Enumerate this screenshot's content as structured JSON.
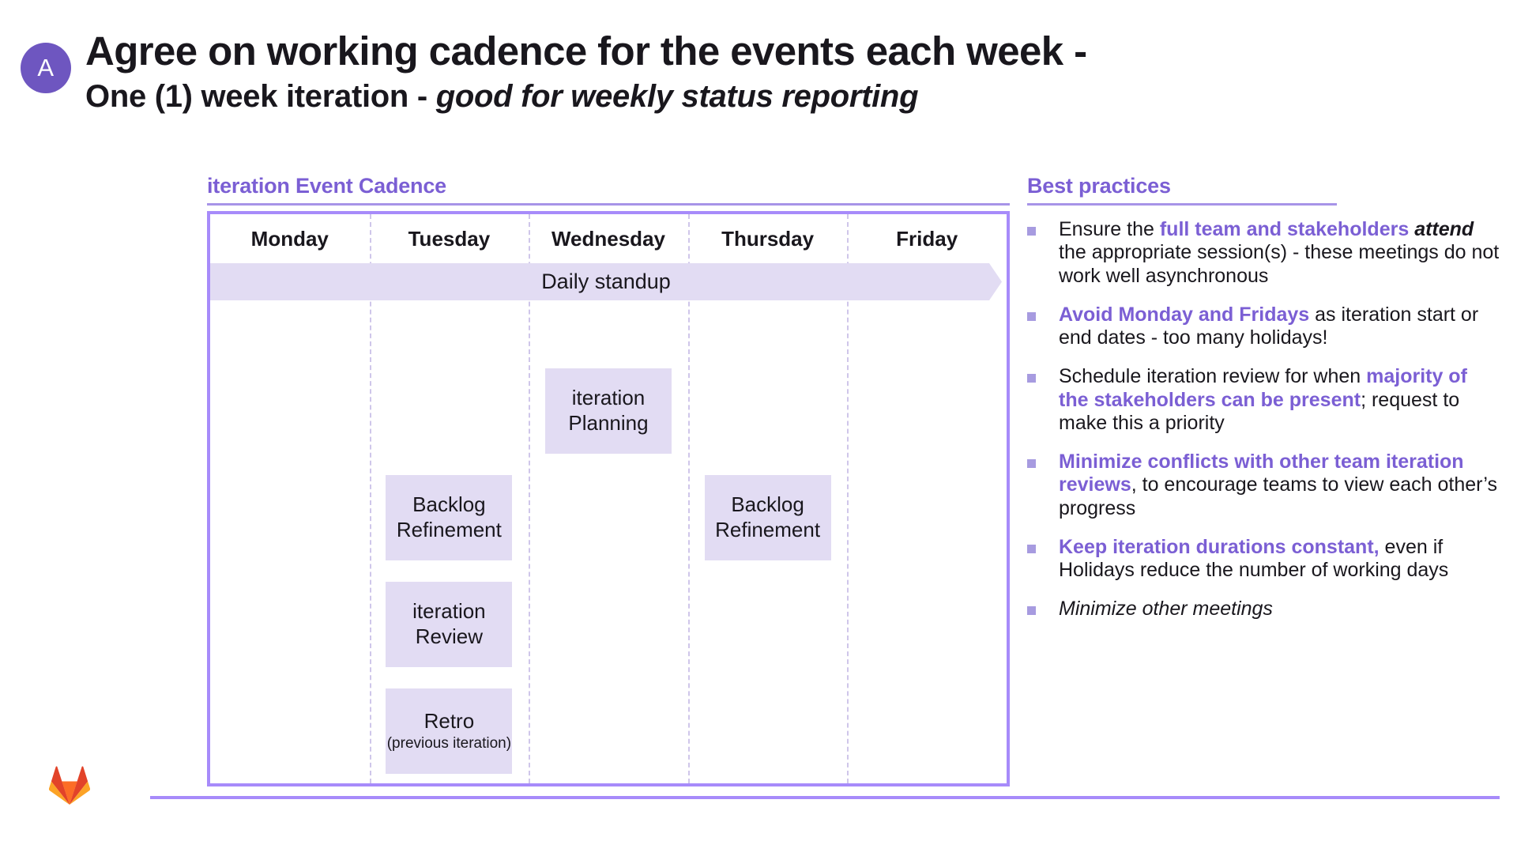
{
  "header": {
    "badge_label": "A",
    "badge_color": "#6E56C0",
    "title": "Agree on working cadence for the events each week -",
    "subtitle_plain": "One (1) week iteration - ",
    "subtitle_italic": "good for weekly status reporting"
  },
  "cadence": {
    "heading": "iteration Event Cadence",
    "accent_color": "#7B5FD4",
    "border_color": "#A78BFA",
    "chip_color": "#E2DCF3",
    "days": [
      "Monday",
      "Tuesday",
      "Wednesday",
      "Thursday",
      "Friday"
    ],
    "standup_label": "Daily standup",
    "events": [
      {
        "day": "Wednesday",
        "label": "iteration Planning",
        "sub": ""
      },
      {
        "day": "Tuesday",
        "label": "Backlog Refinement",
        "sub": ""
      },
      {
        "day": "Thursday",
        "label": "Backlog Refinement",
        "sub": ""
      },
      {
        "day": "Tuesday",
        "label": "iteration Review",
        "sub": ""
      },
      {
        "day": "Tuesday",
        "label": "Retro",
        "sub": "(previous iteration)"
      }
    ]
  },
  "best_practices": {
    "heading": "Best practices",
    "items": [
      {
        "parts": [
          {
            "text": "Ensure the ",
            "style": "plain"
          },
          {
            "text": "full team and stakeholders ",
            "style": "accent-bold"
          },
          {
            "text": "attend",
            "style": "dark-bold-italic"
          },
          {
            "text": " the appropriate session(s) - these meetings do not work well asynchronous",
            "style": "plain"
          }
        ]
      },
      {
        "parts": [
          {
            "text": "Avoid Monday and Fridays",
            "style": "accent-bold"
          },
          {
            "text": " as iteration start or end dates - too many holidays!",
            "style": "plain"
          }
        ]
      },
      {
        "parts": [
          {
            "text": "Schedule iteration review for when ",
            "style": "plain"
          },
          {
            "text": "majority of the stakeholders can be present",
            "style": "accent-bold"
          },
          {
            "text": "; request to make this a priority",
            "style": "plain"
          }
        ]
      },
      {
        "parts": [
          {
            "text": "Minimize conflicts with other team iteration reviews",
            "style": "accent-bold"
          },
          {
            "text": ", to encourage teams to view each other’s progress",
            "style": "plain"
          }
        ]
      },
      {
        "parts": [
          {
            "text": "Keep iteration durations constant,",
            "style": "accent-bold"
          },
          {
            "text": " even if Holidays reduce the number of working days",
            "style": "plain"
          }
        ]
      },
      {
        "parts": [
          {
            "text": "Minimize other meetings",
            "style": "italic"
          }
        ]
      }
    ]
  },
  "footer": {
    "logo_name": "gitlab-logo",
    "rule_color": "#A78BFA"
  }
}
